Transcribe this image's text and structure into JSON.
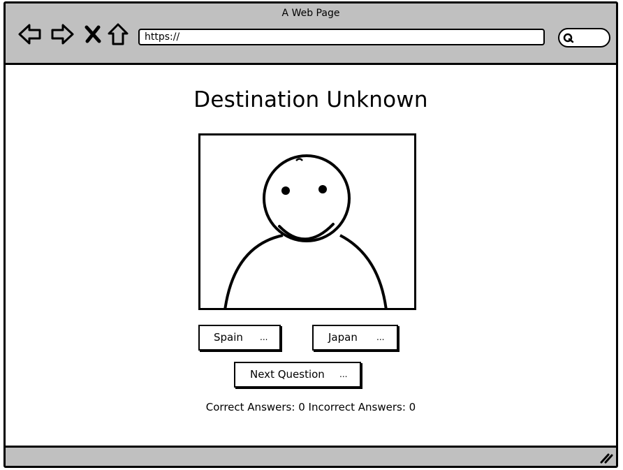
{
  "window": {
    "title": "A Web Page"
  },
  "browser": {
    "url": "https://",
    "icons": [
      "back-arrow-icon",
      "forward-arrow-icon",
      "close-x-icon",
      "home-icon",
      "search-icon",
      "resize-grip-icon"
    ]
  },
  "page": {
    "title": "Destination Unknown",
    "image": "placeholder person illustration"
  },
  "answers": [
    {
      "label": "Spain",
      "suffix": "..."
    },
    {
      "label": "Japan",
      "suffix": "..."
    }
  ],
  "next": {
    "label": "Next Question",
    "suffix": "..."
  },
  "score": {
    "correct_label": "Correct Answers:",
    "correct_value": "0",
    "incorrect_label": "Incorrect Answers:",
    "incorrect_value": "0"
  }
}
